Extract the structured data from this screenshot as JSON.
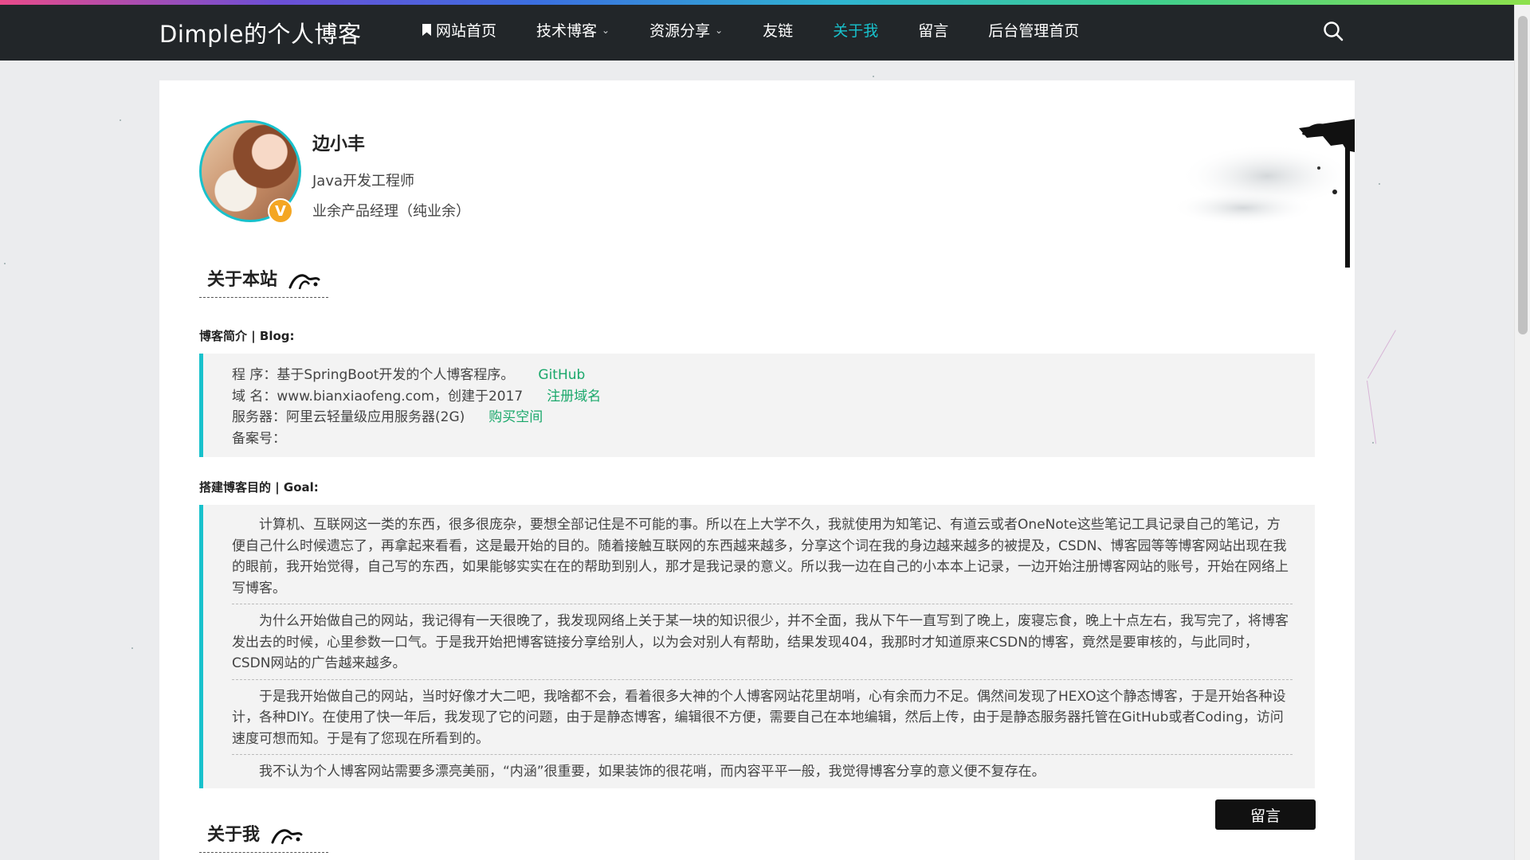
{
  "brand": "Dimple的个人博客",
  "nav": [
    {
      "label": "网站首页",
      "icon": "bookmark-icon",
      "dropdown": false,
      "active": false
    },
    {
      "label": "技术博客",
      "dropdown": true,
      "active": false
    },
    {
      "label": "资源分享",
      "dropdown": true,
      "active": false
    },
    {
      "label": "友链",
      "dropdown": false,
      "active": false
    },
    {
      "label": "关于我",
      "dropdown": false,
      "active": true
    },
    {
      "label": "留言",
      "dropdown": false,
      "active": false
    },
    {
      "label": "后台管理首页",
      "dropdown": false,
      "active": false
    }
  ],
  "profile": {
    "name": "边小丰",
    "title": "Java开发工程师",
    "note": "业余产品经理（纯业余）",
    "badge": "V"
  },
  "about_site": {
    "heading": "关于本站",
    "blog_label": "博客简介 | Blog:",
    "info": [
      {
        "text": "程  序：基于SpringBoot开发的个人博客程序。",
        "link": "GitHub"
      },
      {
        "text": "域  名：www.bianxiaofeng.com，创建于2017",
        "link": "注册域名"
      },
      {
        "text": "服务器：阿里云轻量级应用服务器(2G)",
        "link": "购买空间"
      },
      {
        "text": "备案号：",
        "link": ""
      }
    ],
    "goal_label": "搭建博客目的 | Goal:",
    "goal_paragraphs": [
      "计算机、互联网这一类的东西，很多很庞杂，要想全部记住是不可能的事。所以在上大学不久，我就使用为知笔记、有道云或者OneNote这些笔记工具记录自己的笔记，方便自己什么时候遗忘了，再拿起来看看，这是最开始的目的。随着接触互联网的东西越来越多，分享这个词在我的身边越来越多的被提及，CSDN、博客园等等博客网站出现在我的眼前，我开始觉得，自己写的东西，如果能够实实在在的帮助到别人，那才是我记录的意义。所以我一边在自己的小本本上记录，一边开始注册博客网站的账号，开始在网络上写博客。",
      "为什么开始做自己的网站，我记得有一天很晚了，我发现网络上关于某一块的知识很少，并不全面，我从下午一直写到了晚上，废寝忘食，晚上十点左右，我写完了，将博客发出去的时候，心里参数一口气。于是我开始把博客链接分享给别人，以为会对别人有帮助，结果发现404，我那时才知道原来CSDN的博客，竟然是要审核的，与此同时，CSDN网站的广告越来越多。",
      "于是我开始做自己的网站，当时好像才大二吧，我啥都不会，看着很多大神的个人博客网站花里胡哨，心有余而力不足。偶然间发现了HEXO这个静态博客，于是开始各种设计，各种DIY。在使用了快一年后，我发现了它的问题，由于是静态博客，编辑很不方便，需要自己在本地编辑，然后上传，由于是静态服务器托管在GitHub或者Coding，访问速度可想而知。于是有了您现在所看到的。",
      "我不认为个人博客网站需要多漂亮美丽，“内涵”很重要，如果装饰的很花哨，而内容平平一般，我觉得博客分享的意义便不复存在。"
    ]
  },
  "about_me": {
    "heading": "关于我"
  },
  "message_button": "留言",
  "colors": {
    "accent": "#18c1cc",
    "link": "#1aa86b",
    "navbar": "#222629",
    "badge": "#f4a623"
  }
}
